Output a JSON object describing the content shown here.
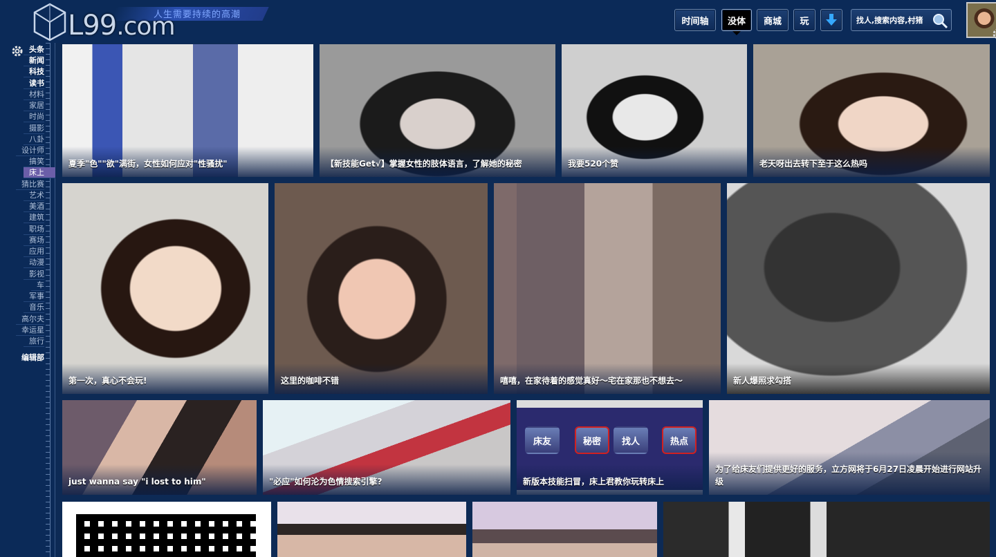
{
  "site": {
    "logo_text": "L99",
    "logo_suffix": ".com",
    "slogan": "人生需要持续的高潮"
  },
  "nav": {
    "timeline": "时间轴",
    "meiti": "没体",
    "mall": "商城",
    "play": "玩",
    "search_placeholder": "找人,搜索内容,村猪"
  },
  "sidebar": {
    "items": [
      "头条",
      "新闻",
      "科技",
      "读书",
      "材料",
      "家居",
      "时尚",
      "摄影",
      "八卦",
      "设计师",
      "搞笑",
      "床上",
      "猜比赛",
      "艺术",
      "美酒",
      "建筑",
      "职场",
      "赛场",
      "应用",
      "动漫",
      "影视",
      "车",
      "军事",
      "音乐",
      "高尔夫",
      "幸运星",
      "旅行"
    ],
    "editor": "编辑部"
  },
  "tiles": [
    {
      "caption": "夏季\"色\"\"欲\"满街，女性如何应对\"性骚扰\""
    },
    {
      "caption": "【新技能Get√】掌握女性的肢体语言，了解她的秘密"
    },
    {
      "caption": "我要520个赞"
    },
    {
      "caption": "老天呀出去转下至于这么热吗"
    },
    {
      "caption": "第一次，真心不会玩!"
    },
    {
      "caption": "这里的咖啡不错"
    },
    {
      "caption": "嘻嘻，在家待着的感觉真好～宅在家那也不想去～"
    },
    {
      "caption": "新人爆照求勾搭"
    },
    {
      "caption": "just wanna say \"i lost to him\""
    },
    {
      "caption": "\"必应\"如何沦为色情搜索引擎?"
    },
    {
      "caption": "新版本技能扫冒，床上君教你玩转床上"
    },
    {
      "caption": "为了给床友们提供更好的服务，立方网将于6月27日凌晨开始进行网站升级"
    },
    {
      "caption": ""
    },
    {
      "caption": ""
    },
    {
      "caption": ""
    },
    {
      "caption": ""
    }
  ],
  "app_buttons": [
    "床友",
    "秘密",
    "找人",
    "热点"
  ],
  "colors": {
    "background": "#0d2a55",
    "sidebar_selected": "#6b5ea8",
    "slogan": "#7fa6ff"
  }
}
